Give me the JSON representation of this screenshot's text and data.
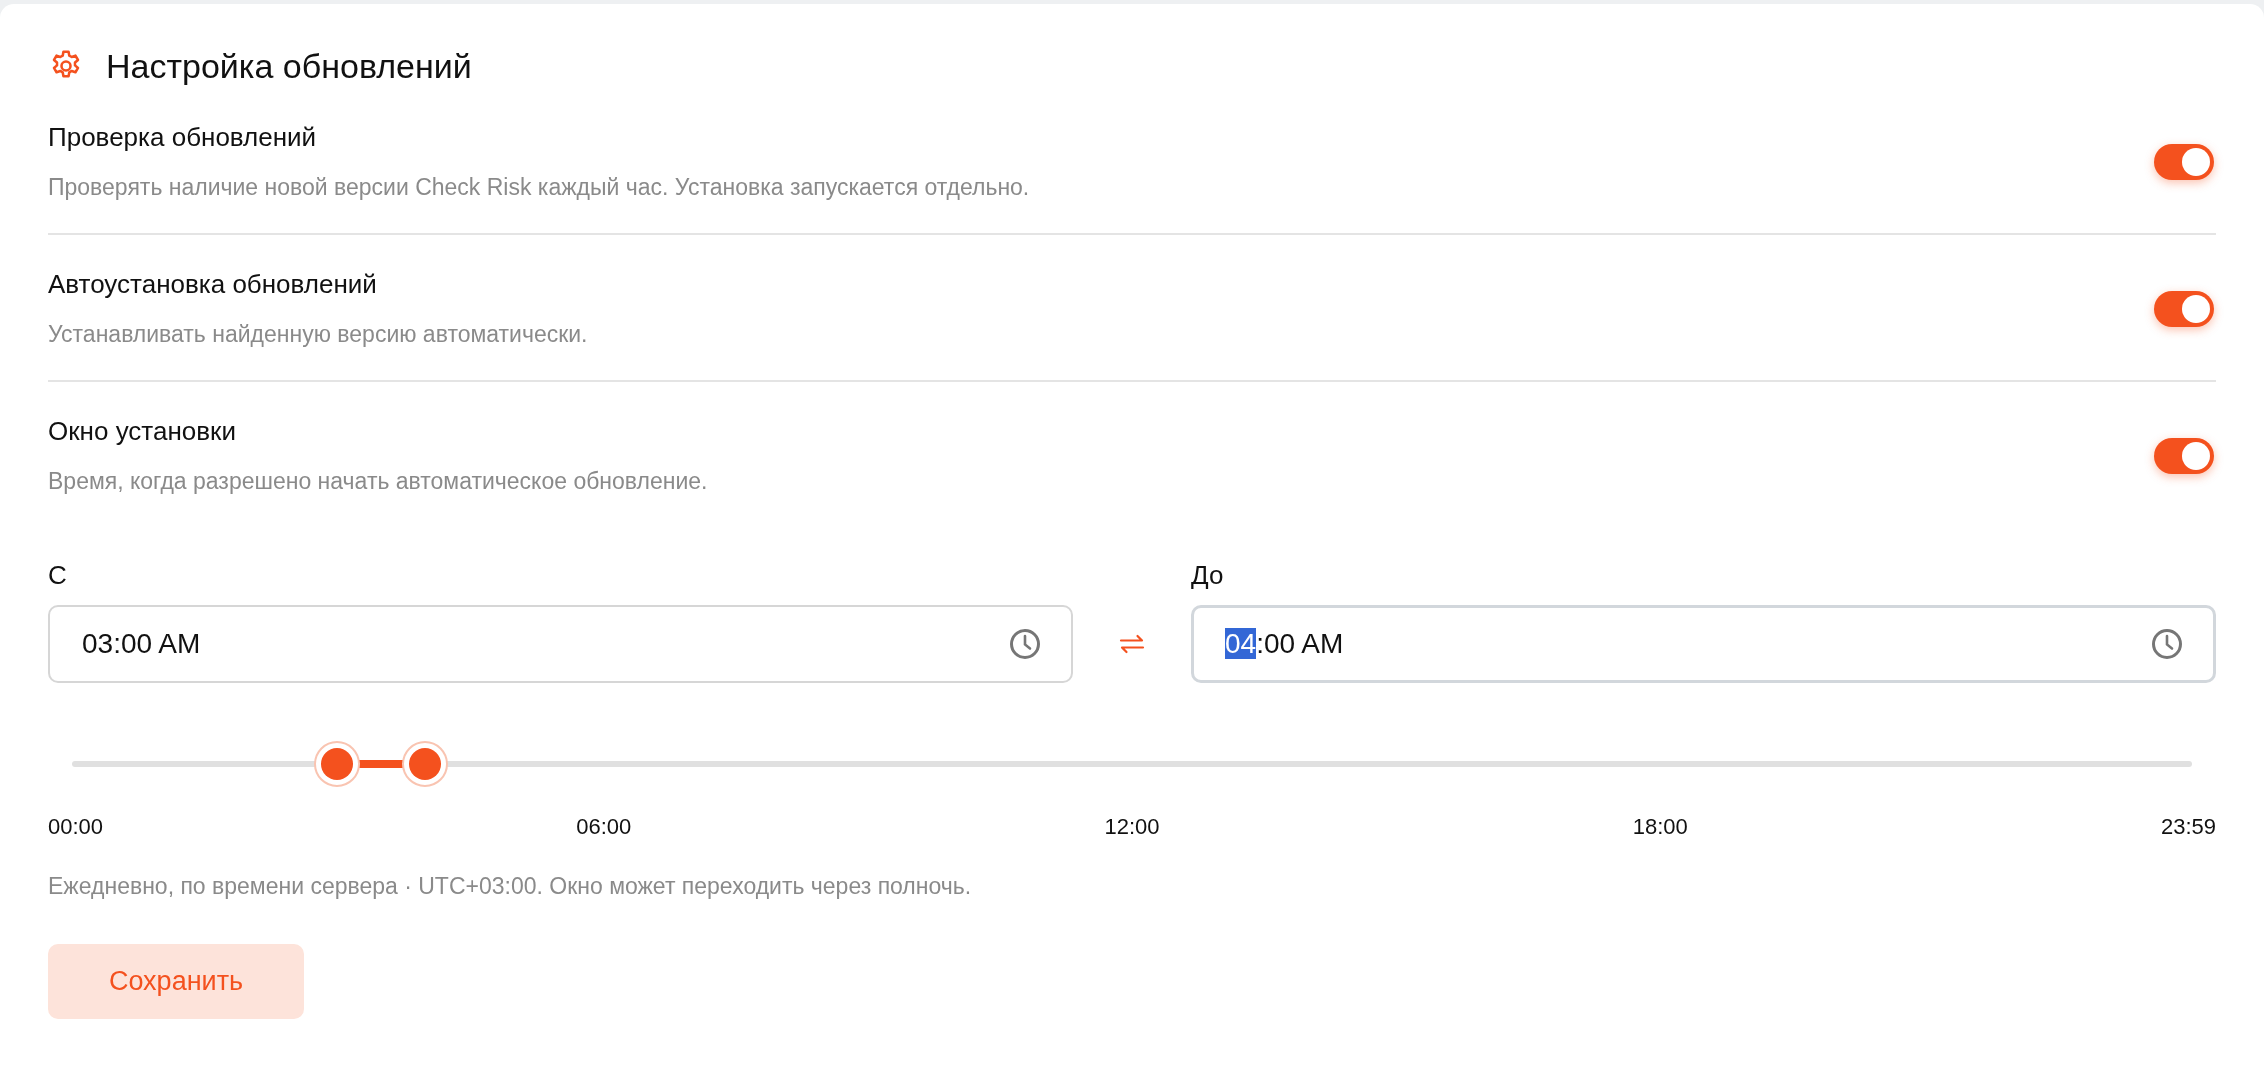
{
  "title": "Настройка обновлений",
  "settings": [
    {
      "label": "Проверка обновлений",
      "description": "Проверять наличие новой версии Check Risk каждый час. Установка запускается отдельно.",
      "on": true
    },
    {
      "label": "Автоустановка обновлений",
      "description": "Устанавливать найденную версию автоматически.",
      "on": true
    },
    {
      "label": "Окно установки",
      "description": "Время, когда разрешено начать автоматическое обновление.",
      "on": true
    }
  ],
  "time_window": {
    "from": {
      "label": "С",
      "focused": false,
      "segments": [
        {
          "text": "03",
          "selected": false
        },
        {
          "text": ":00 AM",
          "selected": false
        }
      ]
    },
    "to": {
      "label": "До",
      "focused": true,
      "segments": [
        {
          "text": "04",
          "selected": true
        },
        {
          "text": ":00 AM",
          "selected": false
        }
      ]
    },
    "thumbs": [
      {
        "level": 0.125
      },
      {
        "level": 0.1667
      }
    ],
    "ticks": [
      "00:00",
      "06:00",
      "12:00",
      "18:00",
      "23:59"
    ],
    "note": "Ежедневно, по времени сервера · UTC+03:00. Окно может переходить через полночь."
  },
  "save_button": "Сохранить"
}
